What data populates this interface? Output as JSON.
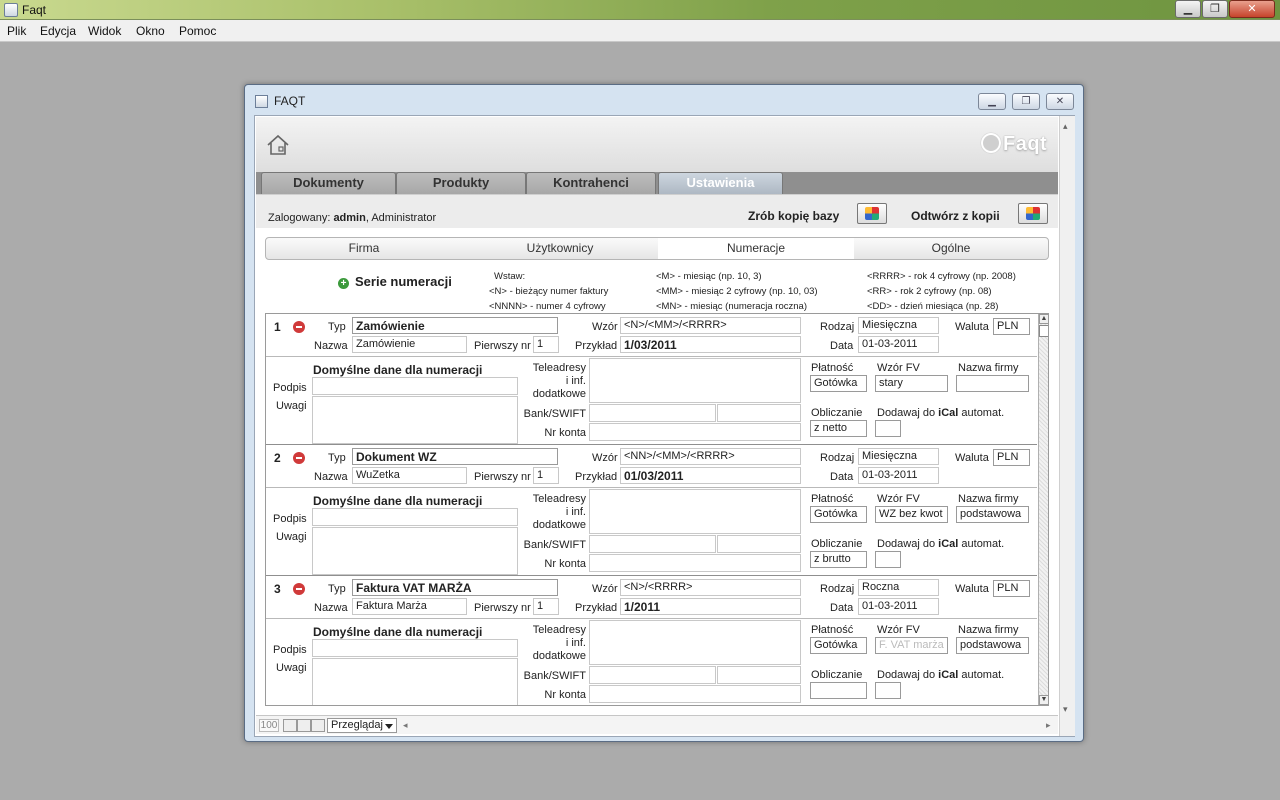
{
  "app": {
    "title": "Faqt"
  },
  "menu": [
    "Plik",
    "Edycja",
    "Widok",
    "Okno",
    "Pomoc"
  ],
  "window": {
    "title": "FAQT"
  },
  "logo": "Faqt",
  "main_tabs": [
    {
      "label": "Dokumenty",
      "active": false
    },
    {
      "label": "Produkty",
      "active": false
    },
    {
      "label": "Kontrahenci",
      "active": false
    },
    {
      "label": "Ustawienia",
      "active": true
    }
  ],
  "login": {
    "prefix": "Zalogowany: ",
    "user": "admin",
    "suffix": ", Administrator"
  },
  "backup": {
    "make": "Zrób kopię bazy",
    "restore": "Odtwórz z kopii"
  },
  "sub_tabs": [
    {
      "label": "Firma",
      "active": false
    },
    {
      "label": "Użytkownicy",
      "active": false
    },
    {
      "label": "Numeracje",
      "active": true
    },
    {
      "label": "Ogólne",
      "active": false
    }
  ],
  "serie_title": "Serie numeracji",
  "legend": {
    "insert": "Wstaw:",
    "n": "<N> - bieżący numer faktury",
    "nnnn": "<NNNN> - numer 4 cyfrowy",
    "m": "<M> - miesiąc (np. 10, 3)",
    "mm": "<MM> - miesiąc 2 cyfrowy (np. 10, 03)",
    "mn": "<MN> - miesiąc (numeracja roczna)",
    "rrrr": "<RRRR> - rok 4 cyfrowy (np. 2008)",
    "rr": "<RR> - rok 2 cyfrowy (np. 08)",
    "dd": "<DD> - dzień miesiąca (np. 28)"
  },
  "labels": {
    "typ": "Typ",
    "nazwa": "Nazwa",
    "pierwszy": "Pierwszy nr",
    "wzor": "Wzór",
    "przyklad": "Przykład",
    "rodzaj": "Rodzaj",
    "data": "Data",
    "waluta": "Waluta",
    "domyslne": "Domyślne dane dla numeracji",
    "podpis": "Podpis",
    "uwagi": "Uwagi",
    "teleadresy1": "Teleadresy",
    "teleadresy2": "i inf.",
    "teleadresy3": "dodatkowe",
    "bank": "Bank/SWIFT",
    "nrkonta": "Nr konta",
    "platnosc": "Płatność",
    "wzorfv": "Wzór FV",
    "nazwafirmy": "Nazwa firmy",
    "obliczanie": "Obliczanie",
    "dodawaj_pre": "Dodawaj do ",
    "dodawaj_ical": "iCal",
    "dodawaj_post": " automat."
  },
  "records": [
    {
      "no": "1",
      "typ": "Zamówienie",
      "nazwa": "Zamówienie",
      "pierwszy": "1",
      "wzor": "<N>/<MM>/<RRRR>",
      "przyklad": "1/03/2011",
      "rodzaj": "Miesięczna",
      "data": "01-03-2011",
      "waluta": "PLN",
      "platnosc": "Gotówka",
      "wzorfv": "stary",
      "wzorfv_placeholder": false,
      "nazwafirmy": "",
      "obliczanie": "z netto"
    },
    {
      "no": "2",
      "typ": "Dokument WZ",
      "nazwa": "WuZetka",
      "pierwszy": "1",
      "wzor": "<NN>/<MM>/<RRRR>",
      "przyklad": "01/03/2011",
      "rodzaj": "Miesięczna",
      "data": "01-03-2011",
      "waluta": "PLN",
      "platnosc": "Gotówka",
      "wzorfv": "WZ bez kwot",
      "wzorfv_placeholder": false,
      "nazwafirmy": "podstawowa",
      "obliczanie": "z brutto"
    },
    {
      "no": "3",
      "typ": "Faktura VAT MARŻA",
      "nazwa": "Faktura Marża",
      "pierwszy": "1",
      "wzor": "<N>/<RRRR>",
      "przyklad": "1/2011",
      "rodzaj": "Roczna",
      "data": "01-03-2011",
      "waluta": "PLN",
      "platnosc": "Gotówka",
      "wzorfv": "F. VAT marża",
      "wzorfv_placeholder": true,
      "nazwafirmy": "podstawowa",
      "obliczanie": ""
    }
  ],
  "footer": {
    "zoom": "100",
    "view": "Przeglądaj"
  }
}
